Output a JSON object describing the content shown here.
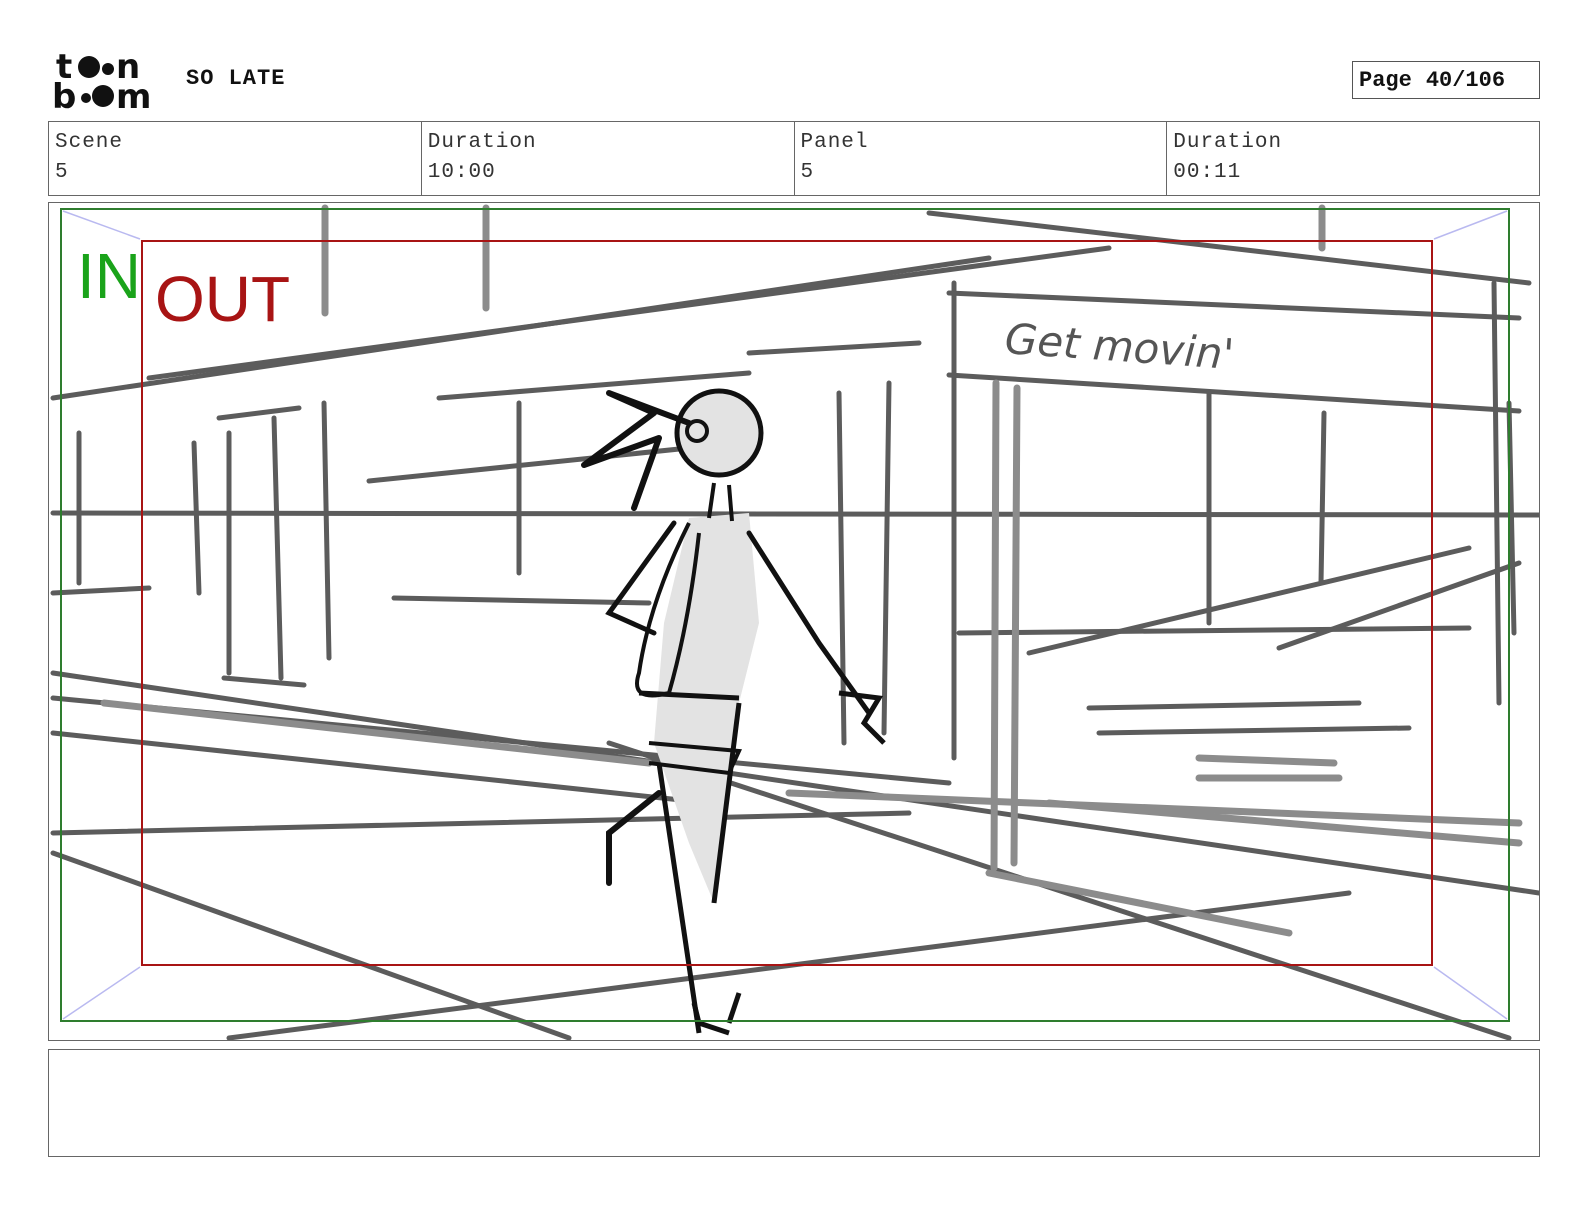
{
  "header": {
    "logo_text": "toon boom",
    "project_title": "SO LATE",
    "page_label": "Page",
    "page_number": "40/106"
  },
  "info": {
    "scene_label": "Scene",
    "scene_value": "5",
    "duration_label": "Duration",
    "duration_value": "10:00",
    "panel_label": "Panel",
    "panel_value": "5",
    "panel_duration_label": "Duration",
    "panel_duration_value": "00:11"
  },
  "frame": {
    "in_label": "IN",
    "out_label": "OUT",
    "in_color": "#1aa31a",
    "out_color": "#a81414"
  },
  "sketch": {
    "bus_text": "Get movin'"
  },
  "notes": {
    "text": ""
  }
}
